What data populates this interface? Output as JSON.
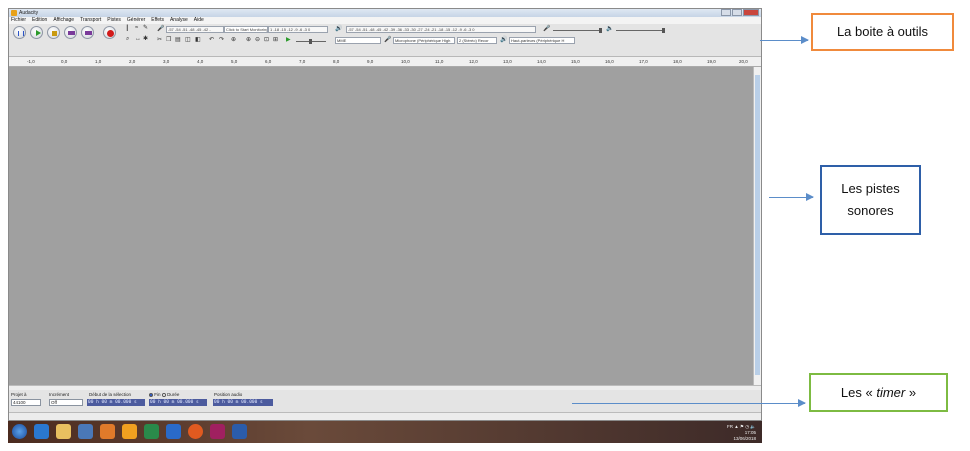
{
  "window": {
    "title": "Audacity"
  },
  "menu": [
    "Fichier",
    "Edition",
    "Affichage",
    "Transport",
    "Pistes",
    "Générer",
    "Effets",
    "Analyse",
    "Aide"
  ],
  "meters": {
    "record_scale": "-57 -54 -51 -48 -45 -42 -",
    "record_hint": "Click to Start Monitoring",
    "record_scale_end": "1 -18 -15 -12 -9 -6 -3 0",
    "play_scale": "-57 -54 -51 -48 -45 -42 -39 -36 -33 -30 -27 -24 -21 -18 -15 -12 -9 -6 -3 0"
  },
  "devices": {
    "host": "MME",
    "microphone": "Microphone (Périphérique High",
    "channels": "2 (Stéréo) Recor",
    "speakers": "Haut-parleurs (Périphérique H"
  },
  "ruler": [
    "-1,0",
    "0,0",
    "1,0",
    "2,0",
    "3,0",
    "4,0",
    "5,0",
    "6,0",
    "7,0",
    "8,0",
    "9,0",
    "10,0",
    "11,0",
    "12,0",
    "13,0",
    "14,0",
    "15,0",
    "16,0",
    "17,0",
    "18,0",
    "19,0",
    "20,0"
  ],
  "selection": {
    "project_rate_label": "Projet à",
    "project_rate": "44100",
    "snap_label": "Incrément",
    "snap_value": "Off",
    "start_label": "Début de la sélection",
    "end_label": "Fin",
    "length_label": "Durée",
    "audio_pos_label": "Position audio",
    "start_time": "00 h 00 m 00.000 s",
    "end_time": "00 h 00 m 00.000 s",
    "audio_time": "00 h 00 m 00.000 s"
  },
  "tray": {
    "lang": "FR",
    "time": "17:05",
    "date": "13/06/2018"
  },
  "annotations": {
    "toolbox": "La boite à outils",
    "tracks": "Les pistes sonores",
    "timer_prefix": "Les «",
    "timer_word": "timer",
    "timer_suffix": "»"
  },
  "colors": {
    "toolbox_border": "#f08a3c",
    "tracks_border": "#2e5fa8",
    "timer_border": "#7dbb42"
  }
}
